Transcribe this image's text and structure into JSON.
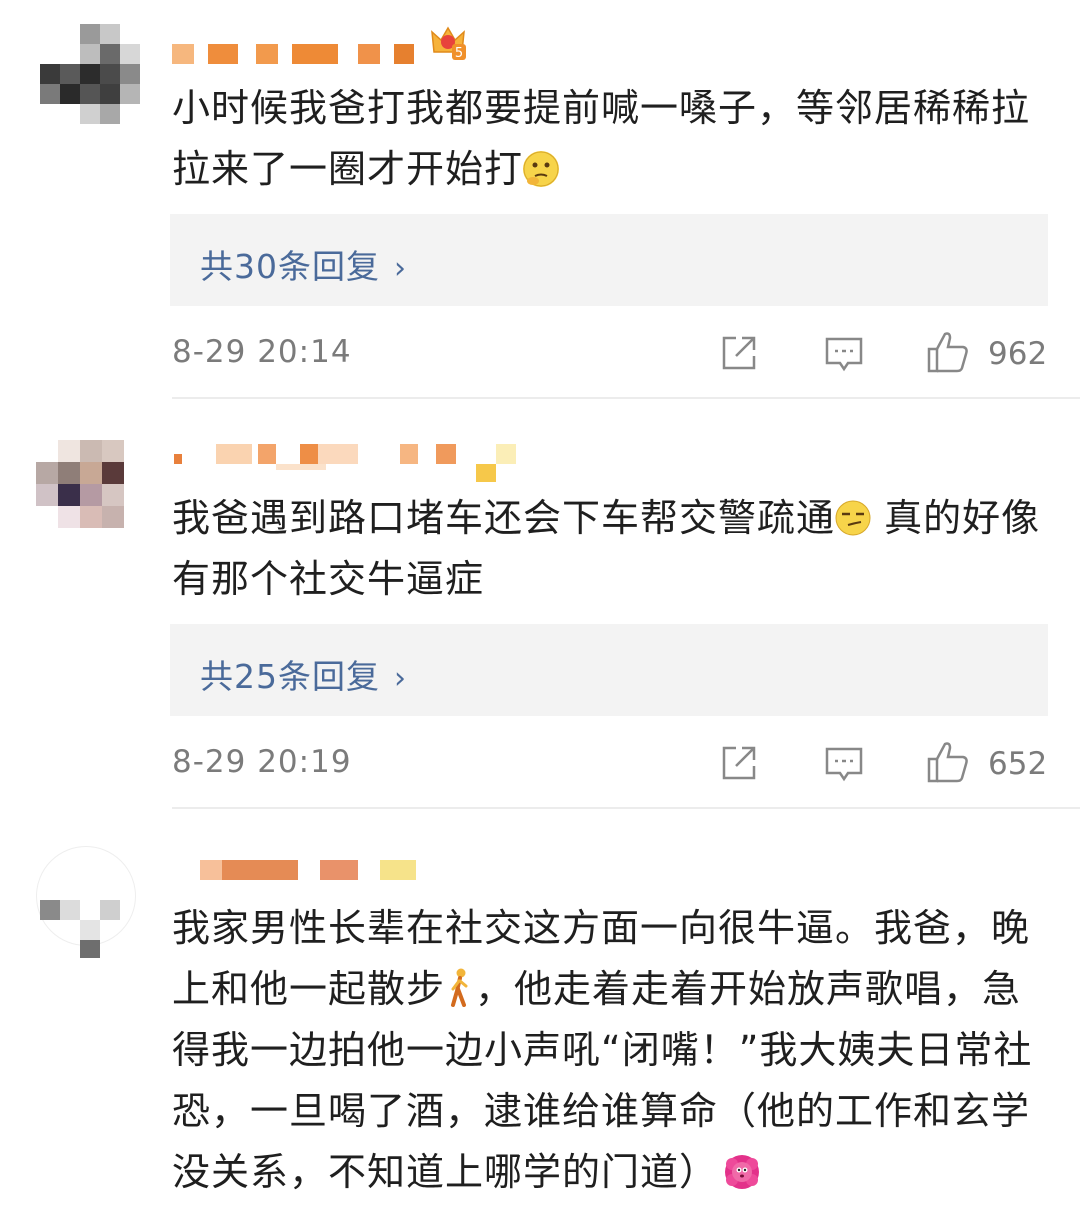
{
  "comments": [
    {
      "text_before_emoji": "小时候我爸打我都要提前喊一嗓子，等邻居稀稀拉拉来了一圈才开始打",
      "text_after_emoji": "",
      "emoji": "thinking-face-emoji",
      "replies_label": "共30条回复",
      "timestamp": "8-29 20:14",
      "likes": "962",
      "badge": "5"
    },
    {
      "text_before_emoji": "我爸遇到路口堵车还会下车帮交警疏通",
      "text_after_emoji": " 真的好像有那个社交牛逼症",
      "emoji": "smirk-face-emoji",
      "replies_label": "共25条回复",
      "timestamp": "8-29 20:19",
      "likes": "652"
    },
    {
      "text_before_emoji": "我家男性长辈在社交这方面一向很牛逼。我爸，晚上和他一起散步",
      "text_middle": "，他走着走着开始放声歌唱，急得我一边拍他一边小声吼“闭嘴！”我大姨夫日常社恐，一旦喝了酒，逮谁给谁算命（他的工作和玄学没关系，不知道上哪学的门道）",
      "emoji": "person-walking-emoji",
      "end_emoji": "flower-face-emoji"
    }
  ],
  "chevron": "›"
}
